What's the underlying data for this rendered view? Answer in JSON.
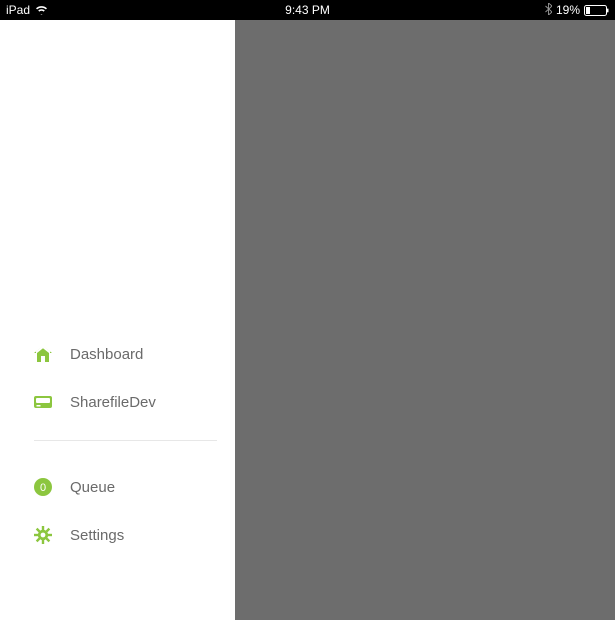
{
  "status_bar": {
    "device": "iPad",
    "time": "9:43 PM",
    "battery_percent": "19%"
  },
  "sidebar": {
    "group1": [
      {
        "label": "Dashboard"
      },
      {
        "label": "SharefileDev"
      }
    ],
    "group2": [
      {
        "label": "Queue",
        "badge": "0"
      },
      {
        "label": "Settings"
      }
    ]
  }
}
